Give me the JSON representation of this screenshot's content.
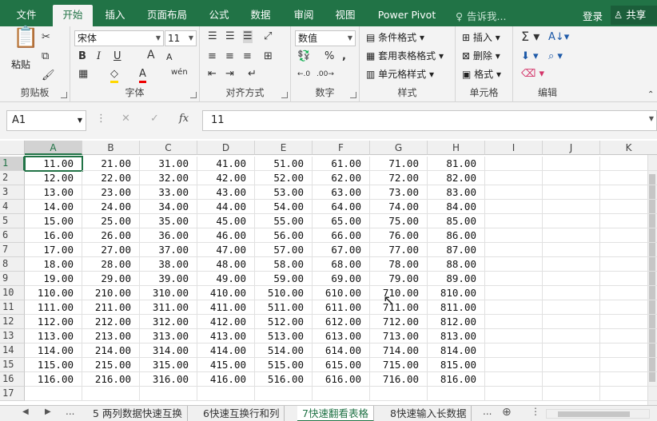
{
  "menu": {
    "tabs": [
      "文件",
      "开始",
      "插入",
      "页面布局",
      "公式",
      "数据",
      "审阅",
      "视图",
      "Power Pivot"
    ],
    "active_tab": "开始",
    "tell_me": "告诉我...",
    "login": "登录",
    "share": "共享"
  },
  "ribbon": {
    "clipboard": {
      "paste": "粘贴",
      "label": "剪贴板"
    },
    "font": {
      "name": "宋体",
      "size": "11",
      "bold": "B",
      "italic": "I",
      "underline": "U",
      "grow": "A",
      "shrink": "A",
      "phonetic": "wén",
      "label": "字体"
    },
    "alignment": {
      "label": "对齐方式"
    },
    "number": {
      "format": "数值",
      "percent": "%",
      "label": "数字"
    },
    "styles": {
      "conditional": "条件格式",
      "table": "套用表格格式",
      "cell": "单元格样式",
      "label": "样式"
    },
    "cells": {
      "insert": "插入",
      "delete": "删除",
      "format": "格式",
      "label": "单元格"
    },
    "editing": {
      "label": "编辑"
    }
  },
  "formula_bar": {
    "name_box": "A1",
    "fx": "fx",
    "value": "11"
  },
  "grid": {
    "columns": [
      "A",
      "B",
      "C",
      "D",
      "E",
      "F",
      "G",
      "H",
      "I",
      "J",
      "K"
    ],
    "rows": [
      "1",
      "2",
      "3",
      "4",
      "5",
      "6",
      "7",
      "8",
      "9",
      "10",
      "11",
      "12",
      "13",
      "14",
      "15",
      "16",
      "17"
    ],
    "cells": [
      [
        "11.00",
        "21.00",
        "31.00",
        "41.00",
        "51.00",
        "61.00",
        "71.00",
        "81.00"
      ],
      [
        "12.00",
        "22.00",
        "32.00",
        "42.00",
        "52.00",
        "62.00",
        "72.00",
        "82.00"
      ],
      [
        "13.00",
        "23.00",
        "33.00",
        "43.00",
        "53.00",
        "63.00",
        "73.00",
        "83.00"
      ],
      [
        "14.00",
        "24.00",
        "34.00",
        "44.00",
        "54.00",
        "64.00",
        "74.00",
        "84.00"
      ],
      [
        "15.00",
        "25.00",
        "35.00",
        "45.00",
        "55.00",
        "65.00",
        "75.00",
        "85.00"
      ],
      [
        "16.00",
        "26.00",
        "36.00",
        "46.00",
        "56.00",
        "66.00",
        "76.00",
        "86.00"
      ],
      [
        "17.00",
        "27.00",
        "37.00",
        "47.00",
        "57.00",
        "67.00",
        "77.00",
        "87.00"
      ],
      [
        "18.00",
        "28.00",
        "38.00",
        "48.00",
        "58.00",
        "68.00",
        "78.00",
        "88.00"
      ],
      [
        "19.00",
        "29.00",
        "39.00",
        "49.00",
        "59.00",
        "69.00",
        "79.00",
        "89.00"
      ],
      [
        "110.00",
        "210.00",
        "310.00",
        "410.00",
        "510.00",
        "610.00",
        "710.00",
        "810.00"
      ],
      [
        "111.00",
        "211.00",
        "311.00",
        "411.00",
        "511.00",
        "611.00",
        "711.00",
        "811.00"
      ],
      [
        "112.00",
        "212.00",
        "312.00",
        "412.00",
        "512.00",
        "612.00",
        "712.00",
        "812.00"
      ],
      [
        "113.00",
        "213.00",
        "313.00",
        "413.00",
        "513.00",
        "613.00",
        "713.00",
        "813.00"
      ],
      [
        "114.00",
        "214.00",
        "314.00",
        "414.00",
        "514.00",
        "614.00",
        "714.00",
        "814.00"
      ],
      [
        "115.00",
        "215.00",
        "315.00",
        "415.00",
        "515.00",
        "615.00",
        "715.00",
        "815.00"
      ],
      [
        "116.00",
        "216.00",
        "316.00",
        "416.00",
        "516.00",
        "616.00",
        "716.00",
        "816.00"
      ],
      [
        "",
        "",
        "",
        "",
        "",
        "",
        "",
        ""
      ]
    ]
  },
  "sheets": {
    "tabs": [
      "5 两列数据快速互换",
      "6快速互换行和列",
      "7快速翻看表格",
      "8快速输入长数据"
    ],
    "active": "7快速翻看表格",
    "more": "..."
  }
}
